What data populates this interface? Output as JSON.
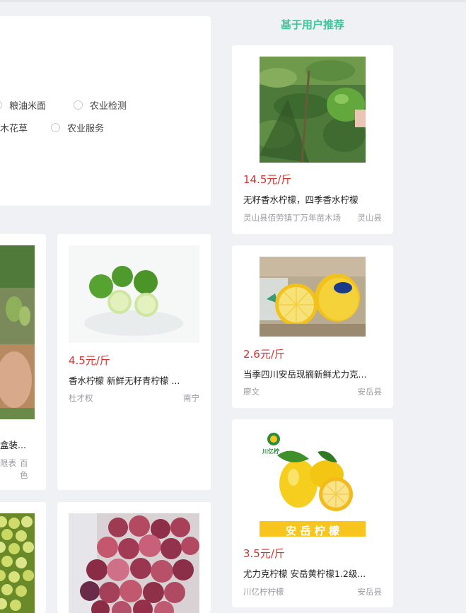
{
  "filter": {
    "options": [
      {
        "label": "粮油米面"
      },
      {
        "label": "农业检测"
      },
      {
        "label": "木花草"
      },
      {
        "label": "农业服务"
      }
    ]
  },
  "recommend": {
    "title": "基于用户推荐",
    "items": [
      {
        "price": "14.5元/斤",
        "name": "无籽香水柠檬，四季香水柠檬",
        "seller": "灵山县佰劳镇丁万年苗木场",
        "location": "灵山县"
      },
      {
        "price": "2.6元/斤",
        "name": "当季四川安岳现摘新鲜尤力克...",
        "seller": "廖文",
        "location": "安岳县"
      },
      {
        "price": "3.5元/斤",
        "name": "尤力克柠檬 安岳黄柠檬1.2级...",
        "seller": "川亿柠柠檬",
        "location": "安岳县",
        "logo_text": "川亿柠",
        "banner_text": "安 岳 柠 檬"
      }
    ]
  },
  "grid": {
    "left_partial": {
      "name": "盒装...",
      "seller": "限表",
      "location": "百色"
    },
    "lime": {
      "price": "4.5元/斤",
      "name": "香水柠檬 新鲜无籽青柠檬 ...",
      "seller": "杜才权",
      "location": "南宁"
    }
  },
  "colors": {
    "price": "#d9302c",
    "accent": "#3ec79a"
  }
}
